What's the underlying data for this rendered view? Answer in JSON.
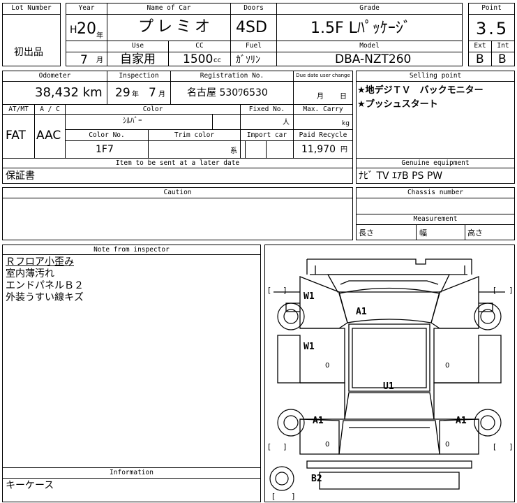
{
  "header": {
    "lot_number_label": "Lot Number",
    "lot_number_value": "",
    "shuppin_label": "初出品",
    "year_label": "Year",
    "year_era": "H",
    "year_value": "20",
    "year_unit": "年",
    "month_value": "7",
    "month_unit": "月",
    "name_label": "Name of Car",
    "name_value": "プレミオ",
    "use_label": "Use",
    "use_value": "自家用",
    "cc_label": "CC",
    "cc_value": "1500",
    "cc_unit": "cc",
    "doors_label": "Doors",
    "doors_value": "4SD",
    "fuel_label": "Fuel",
    "fuel_value": "ｶﾞｿﾘﾝ",
    "grade_label": "Grade",
    "grade_value": "1.5F Lﾊﾟｯｹｰｼﾞ",
    "model_label": "Model",
    "model_value": "DBA-NZT260",
    "point_label": "Point",
    "point_value": "3.5",
    "ext_label": "Ext",
    "ext_value": "B",
    "int_label": "Int",
    "int_value": "B"
  },
  "details": {
    "odometer_label": "Odometer",
    "odometer_value": "38,432 km",
    "inspection_label": "Inspection",
    "inspection_year": "29",
    "inspection_year_unit": "年",
    "inspection_month": "7",
    "inspection_month_unit": "月",
    "registration_label": "Registration No.",
    "registration_value": "名古屋 530ﾜ6530",
    "due_label": "Due date user change",
    "due_month_unit": "月",
    "due_day_unit": "日",
    "selling_point_label": "Selling point",
    "selling_points": [
      "★地デジＴＶ　バックモニター",
      "★プッシュスタート"
    ],
    "atmt_label": "AT/MT",
    "atmt_value": "FAT",
    "ac_label": "A / C",
    "ac_value": "AAC",
    "color_label": "Color",
    "color_value": "ｼﾙﾊﾞｰ",
    "fixed_no_label": "Fixed No.",
    "fixed_no_unit": "人",
    "max_carry_label": "Max. Carry",
    "max_carry_unit": "kg",
    "color_no_label": "Color No.",
    "color_no_value": "1F7",
    "trim_color_label": "Trim color",
    "trim_unit": "系",
    "import_car_label": "Import car",
    "paid_recycle_label": "Paid Recycle",
    "paid_recycle_value": "11,970",
    "paid_recycle_unit": "円",
    "later_label": "Item to be sent at a later date",
    "later_value": "保証書",
    "genuine_label": "Genuine equipment",
    "genuine_value": "ﾅﾋﾞ TV ｴｱB PS PW",
    "caution_label": "Caution",
    "chassis_label": "Chassis number",
    "measurement_label": "Measurement",
    "length_label": "長さ",
    "width_label": "幅",
    "height_label": "高さ"
  },
  "inspector": {
    "note_label": "Note from inspector",
    "notes": [
      "Ｒフロア小歪み",
      "室内薄汚れ",
      "エンドパネルＢ２",
      "外装うすい線キズ"
    ],
    "information_label": "Information",
    "information_value": "キーケース"
  },
  "diagram": {
    "marks": [
      "W1",
      "A1",
      "W1",
      "U1",
      "A1",
      "A1",
      "B2"
    ],
    "bracket_open": "[",
    "bracket_close": "]",
    "zero": "0"
  }
}
